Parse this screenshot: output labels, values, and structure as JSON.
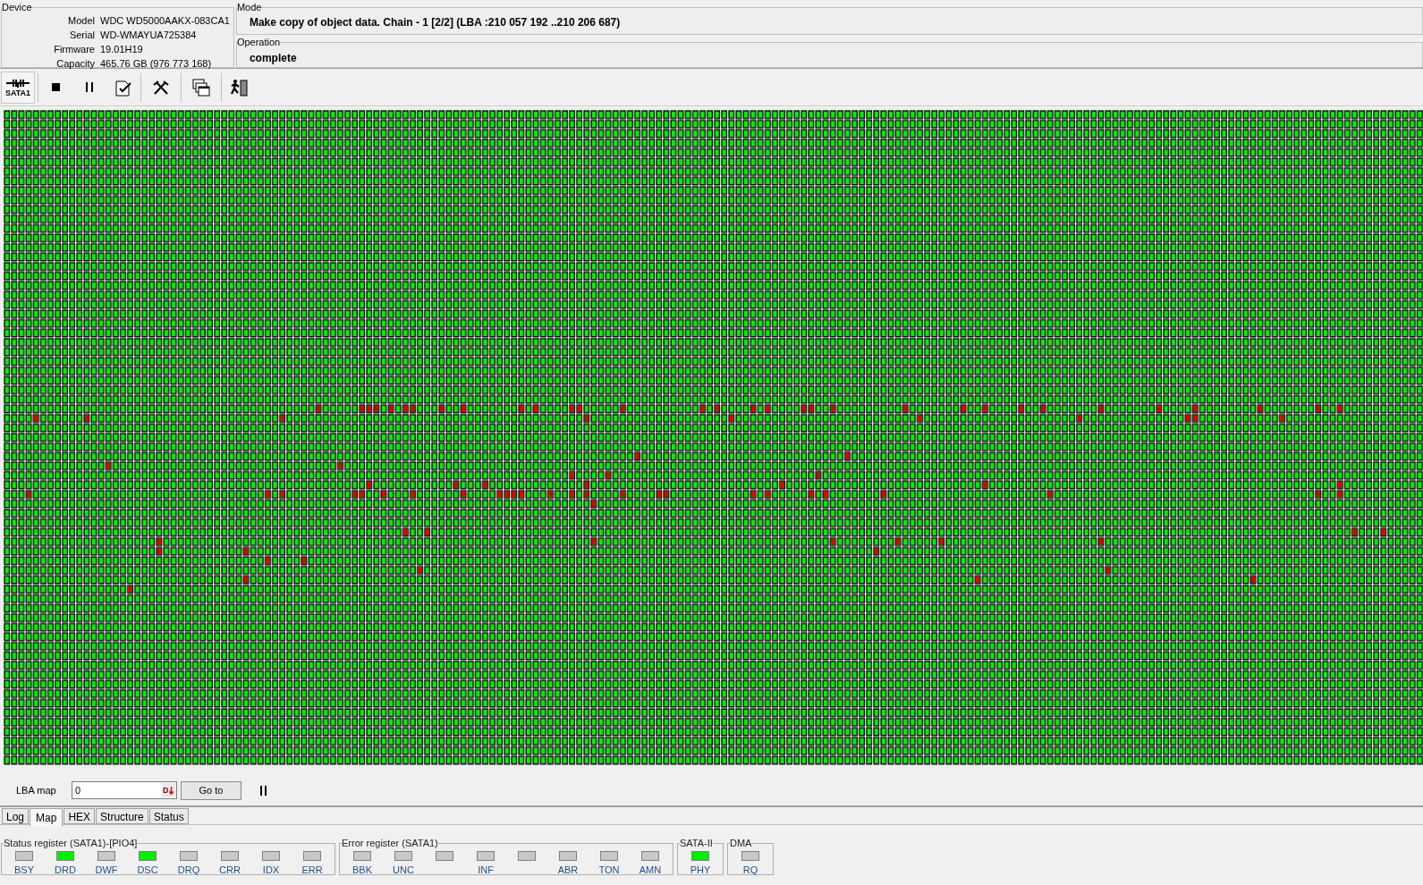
{
  "device": {
    "title": "Device",
    "fields": [
      {
        "label": "Model",
        "value": "WDC WD5000AAKX-083CA1"
      },
      {
        "label": "Serial",
        "value": "WD-WMAYUA725384"
      },
      {
        "label": "Firmware",
        "value": "19.01H19"
      },
      {
        "label": "Capacity",
        "value": "465.76 GB (976 773 168)"
      }
    ]
  },
  "mode": {
    "title": "Mode",
    "value": "Make copy of object data. Chain - 1 [2/2] (LBA :210 057 192 ..210 206 687)"
  },
  "operation": {
    "title": "Operation",
    "value": "complete"
  },
  "toolbar": {
    "port_label": "SATA1"
  },
  "lba_bar": {
    "label": "LBA map",
    "value": "0",
    "dropdown_glyph": "D",
    "goto": "Go to"
  },
  "tabs": [
    {
      "label": "Log",
      "selected": false
    },
    {
      "label": "Map",
      "selected": true
    },
    {
      "label": "HEX",
      "selected": false
    },
    {
      "label": "Structure",
      "selected": false
    },
    {
      "label": "Status",
      "selected": false
    }
  ],
  "registers": [
    {
      "title": "Status register (SATA1)-[PIO4]",
      "leds": [
        {
          "label": "BSY",
          "on": false
        },
        {
          "label": "DRD",
          "on": true
        },
        {
          "label": "DWF",
          "on": false
        },
        {
          "label": "DSC",
          "on": true
        },
        {
          "label": "DRQ",
          "on": false
        },
        {
          "label": "CRR",
          "on": false
        },
        {
          "label": "IDX",
          "on": false
        },
        {
          "label": "ERR",
          "on": false
        }
      ]
    },
    {
      "title": "Error register (SATA1)",
      "leds": [
        {
          "label": "BBK",
          "on": false
        },
        {
          "label": "UNC",
          "on": false
        },
        {
          "on": false
        },
        {
          "label": "INF",
          "on": false
        },
        {
          "on": false
        },
        {
          "label": "ABR",
          "on": false
        },
        {
          "label": "TON",
          "on": false
        },
        {
          "label": "AMN",
          "on": false
        }
      ]
    },
    {
      "title": "SATA-II",
      "leds": [
        {
          "label": "PHY",
          "on": true
        }
      ]
    },
    {
      "title": "DMA",
      "leds": [
        {
          "label": "RQ",
          "on": false
        }
      ]
    }
  ]
}
